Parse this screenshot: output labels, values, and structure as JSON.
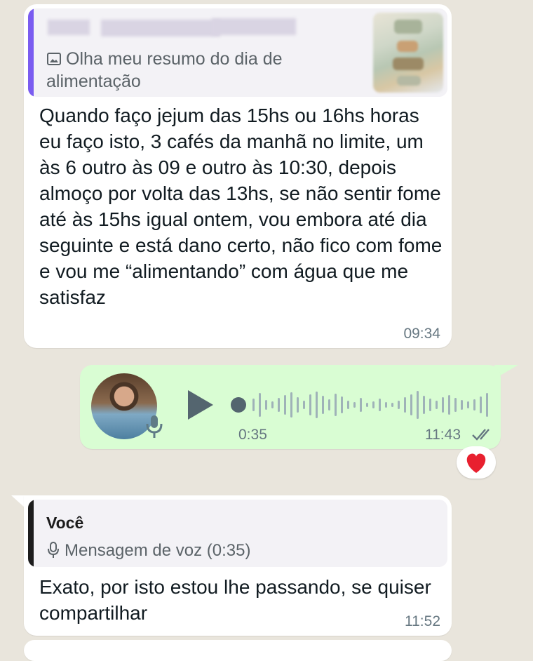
{
  "messages": {
    "first": {
      "quote_text": "Olha meu resumo do dia de alimentação",
      "body": "Quando faço jejum das 15hs ou 16hs horas eu faço isto, 3 cafés da manhã no limite, um às 6 outro às 09 e outro às 10:30, depois almoço por volta das 13hs, se não sentir fome até às 15hs igual ontem, vou embora até dia seguinte e está dano certo, não fico com fome e vou me “alimentando” com água que me satisfaz",
      "time": "09:34"
    },
    "voice": {
      "duration": "0:35",
      "time": "11:43",
      "reaction": "❤️"
    },
    "reply": {
      "quote_sender": "Você",
      "quote_text": "Mensagem de voz (0:35)",
      "body": "Exato, por isto estou lhe passando, se quiser compartilhar",
      "time": "11:52"
    }
  },
  "colors": {
    "background": "#e9e5dc",
    "incoming": "#ffffff",
    "outgoing": "#d9fdd3",
    "quote_accent_purple": "#7a5cf0",
    "read_ticks": "#667781"
  },
  "icons": [
    "image-icon",
    "play-icon",
    "mic-icon",
    "double-check-icon",
    "heart-reaction-icon"
  ]
}
